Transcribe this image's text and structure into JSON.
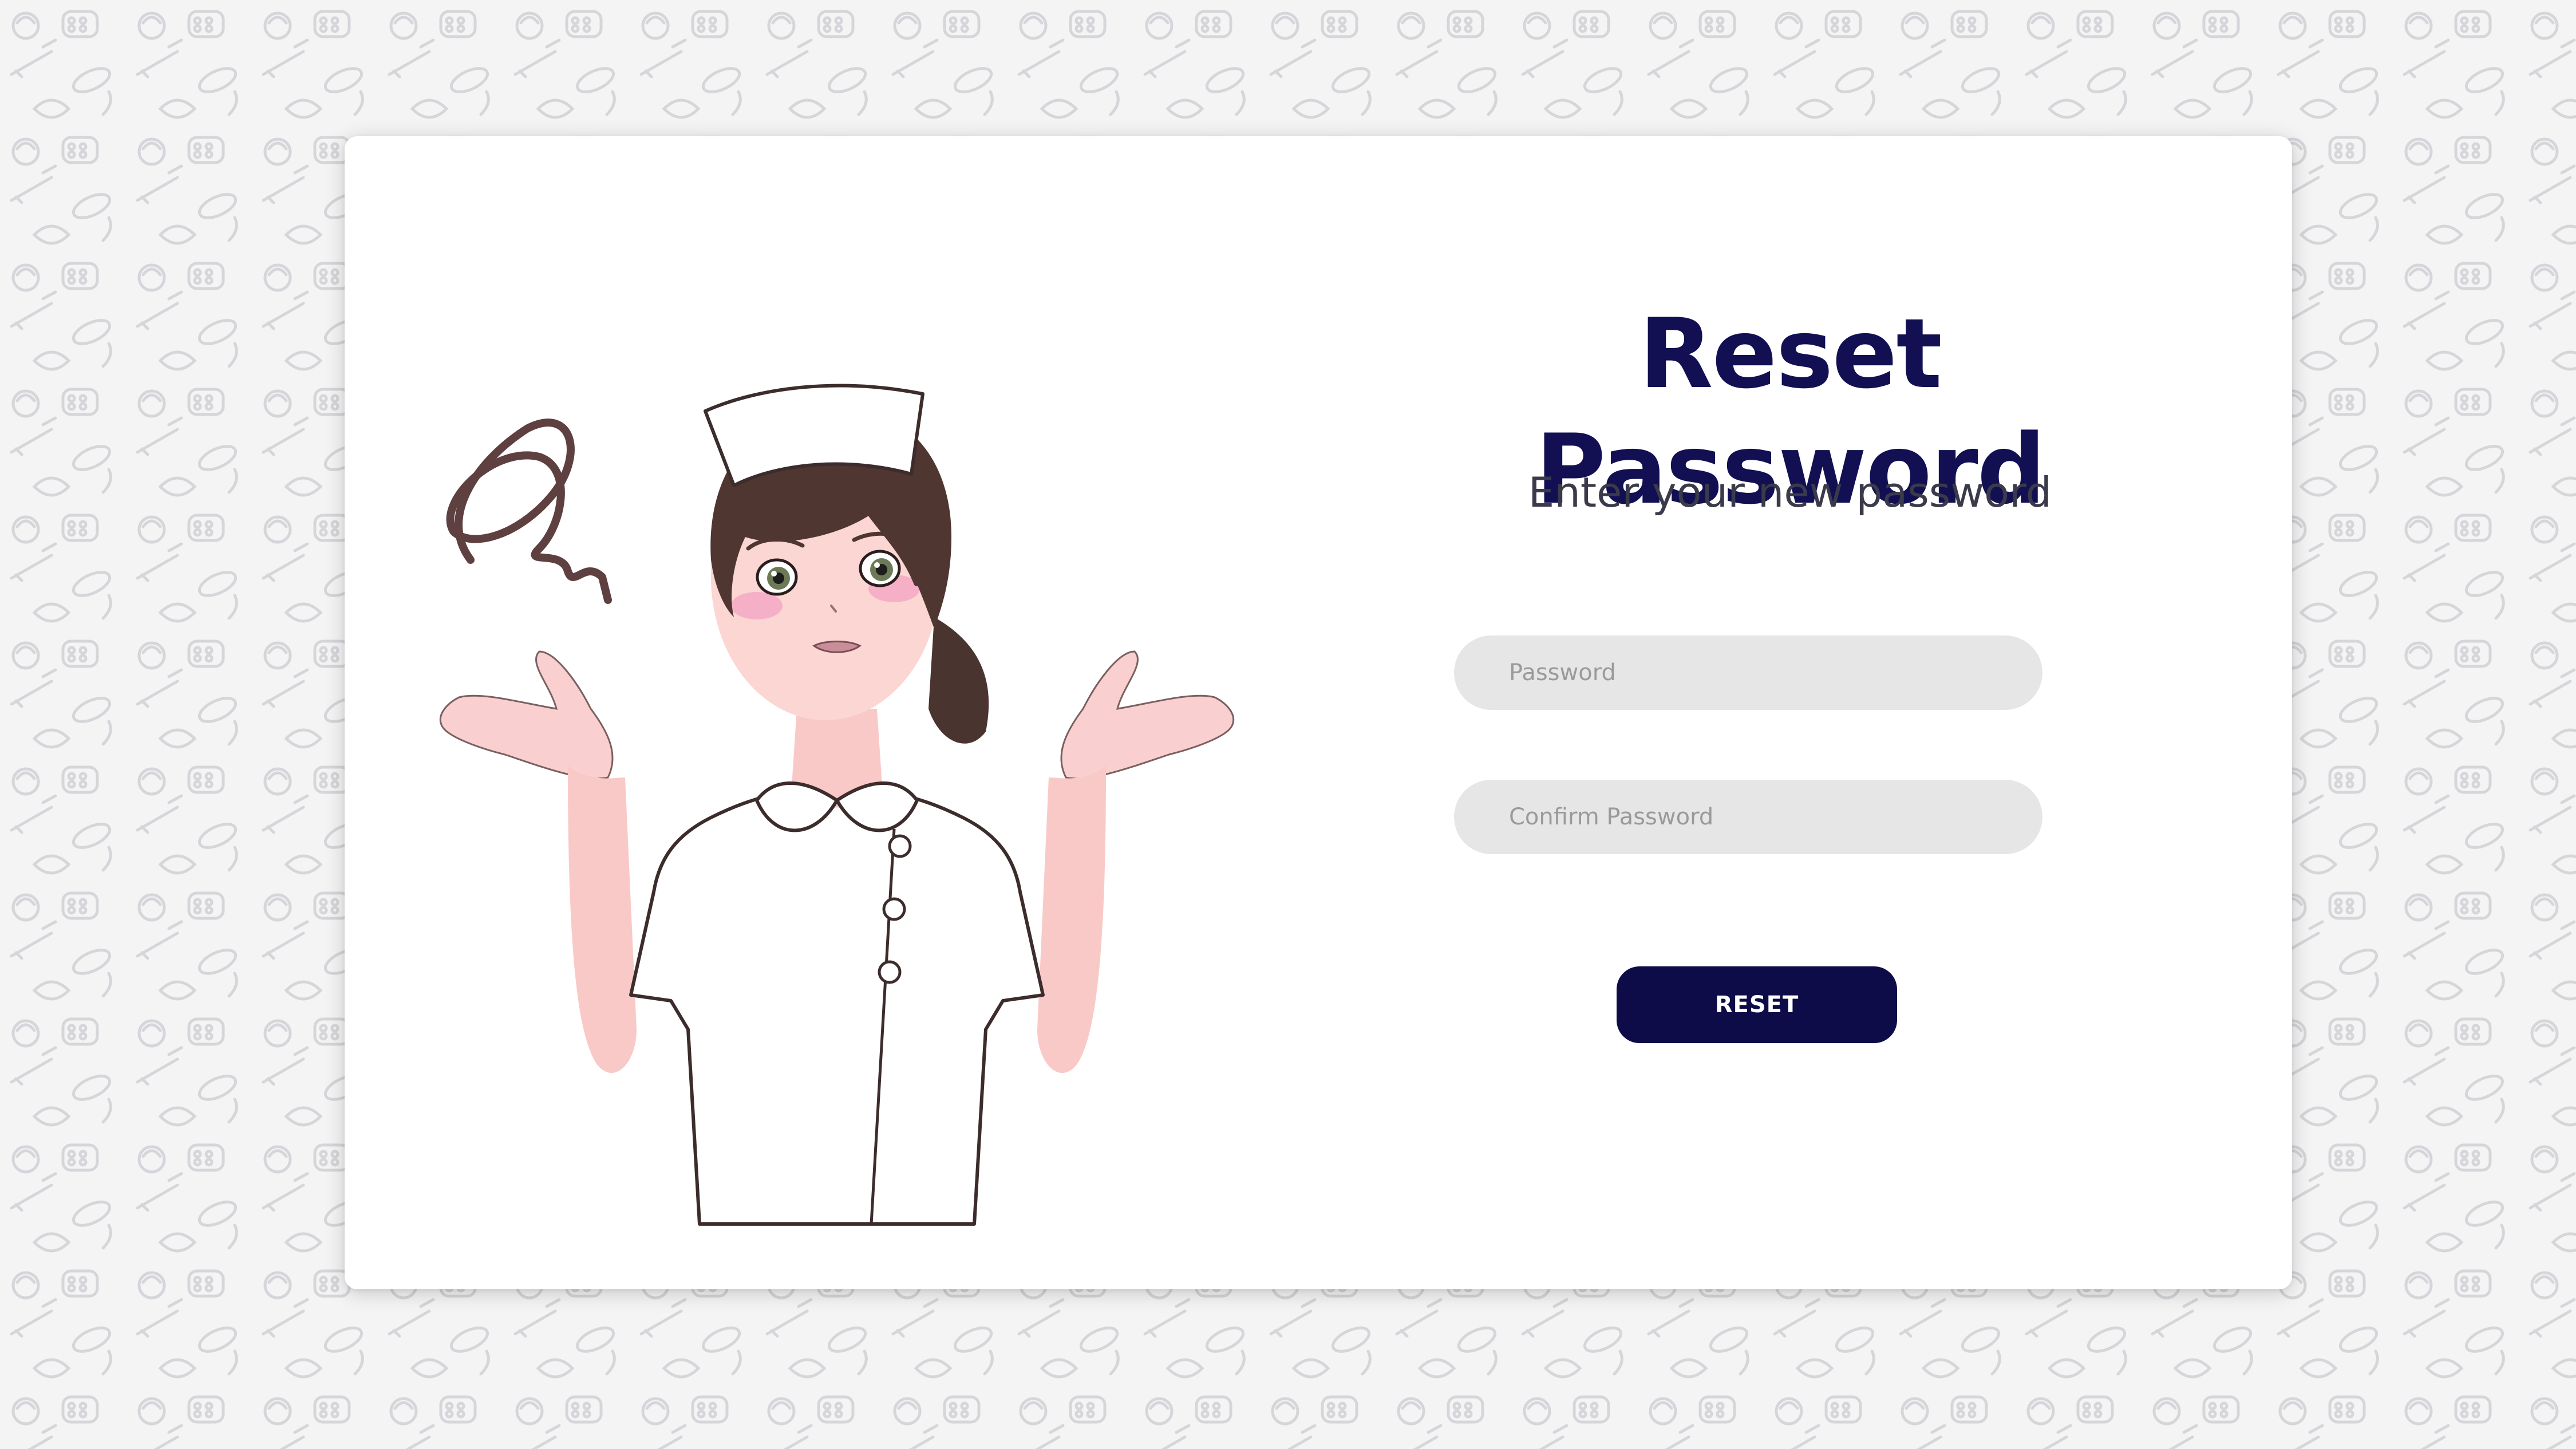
{
  "colors": {
    "title": "#121053",
    "button_background": "#0e0c48",
    "button_text": "#ffffff",
    "input_background": "#e6e6e6",
    "page_background": "#f4f4f5"
  },
  "illustration": {
    "icon": "confused-nurse-illustration"
  },
  "form": {
    "title": "Reset Password",
    "subtitle": "Enter your new password",
    "password_placeholder": "Password",
    "confirm_password_placeholder": "Confirm Password",
    "reset_label": "RESET"
  }
}
